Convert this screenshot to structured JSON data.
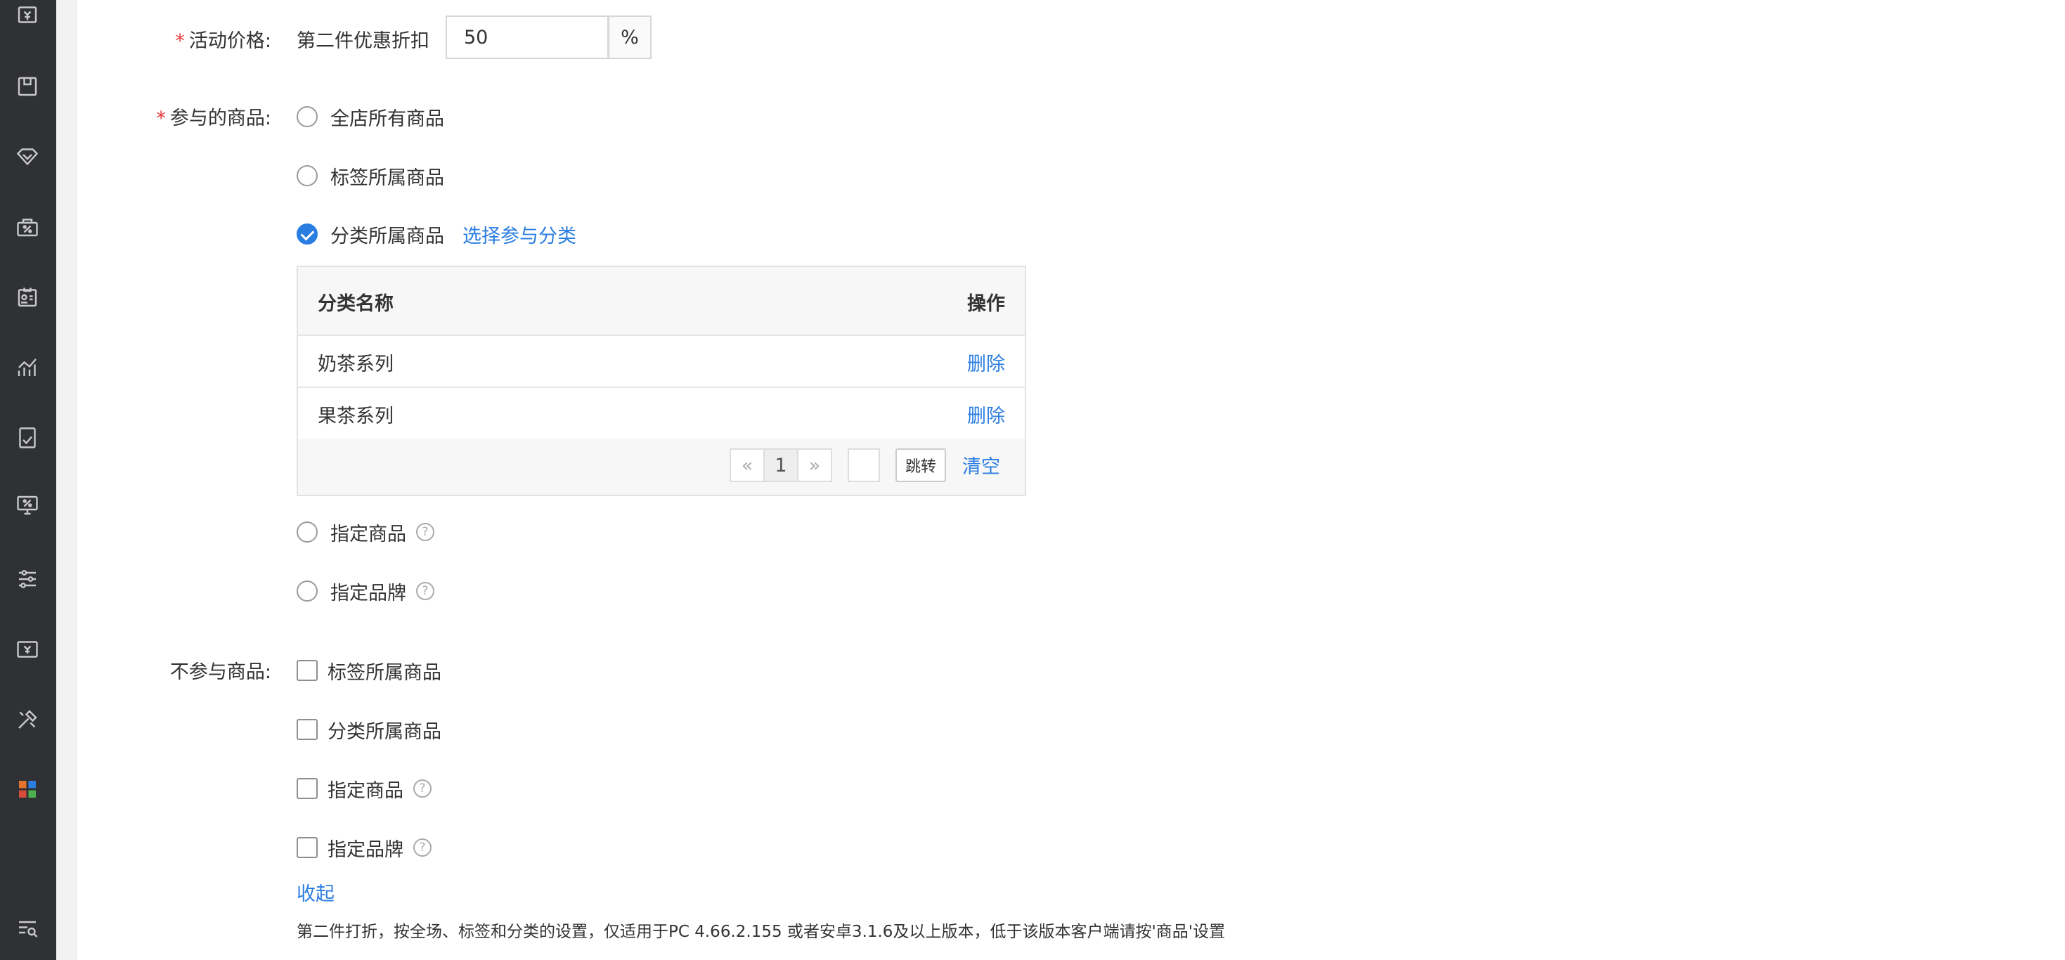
{
  "form": {
    "price_label": "活动价格:",
    "price_prefix": "第二件优惠折扣",
    "price_value": "50",
    "price_unit": "%",
    "participating_label": "参与的商品:",
    "participating_options": [
      {
        "label": "全店所有商品",
        "checked": false
      },
      {
        "label": "标签所属商品",
        "checked": false
      },
      {
        "label": "分类所属商品",
        "checked": true
      },
      {
        "label": "指定商品",
        "checked": false
      },
      {
        "label": "指定品牌",
        "checked": false
      }
    ],
    "select_category_link": "选择参与分类",
    "excluded_label": "不参与商品:",
    "excluded_options": [
      {
        "label": "标签所属商品",
        "checked": false
      },
      {
        "label": "分类所属商品",
        "checked": false
      },
      {
        "label": "指定商品",
        "checked": false
      },
      {
        "label": "指定品牌",
        "checked": false
      }
    ],
    "collapse_link": "收起",
    "note": "第二件打折，按全场、标签和分类的设置，仅适用于PC 4.66.2.155 或者安卓3.1.6及以上版本，低于该版本客户端请按'商品'设置"
  },
  "category_table": {
    "headers": [
      "分类名称",
      "操作"
    ],
    "rows": [
      {
        "name": "奶茶系列",
        "action": "删除"
      },
      {
        "name": "果茶系列",
        "action": "删除"
      }
    ],
    "pagination": {
      "prev": "«",
      "current": "1",
      "next": "»",
      "jump_label": "跳转",
      "clear_label": "清空"
    }
  },
  "help_icon": "?",
  "sidebar_icons": [
    "money-icon",
    "box-icon",
    "diamond-icon",
    "discount-bag-icon",
    "member-card-icon",
    "chart-icon",
    "report-icon",
    "monitor-percent-icon",
    "sliders-icon",
    "ticket-icon",
    "tools-icon",
    "apps-grid-icon",
    "search-list-icon"
  ],
  "colors": {
    "accent": "#2a7de1",
    "required": "#e4393c",
    "sidebar": "#2f3134"
  }
}
